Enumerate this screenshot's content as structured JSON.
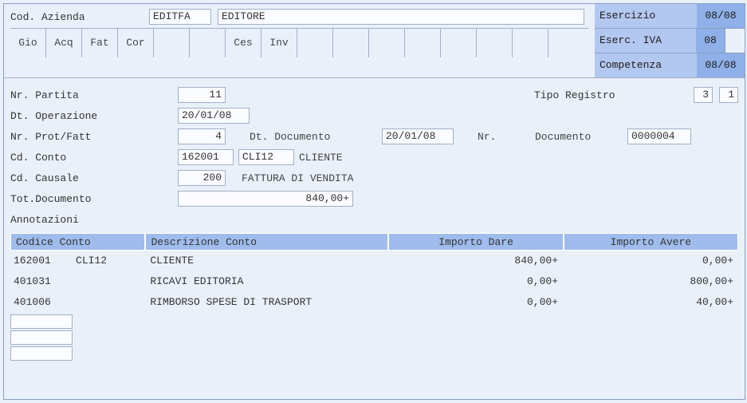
{
  "header": {
    "cod_azienda_label": "Cod. Azienda",
    "cod_azienda_code": "EDITFA",
    "cod_azienda_name": "EDITORE"
  },
  "exercise": {
    "esercizio_label": "Esercizio",
    "esercizio_val": "08/08",
    "eserc_iva_label": "Eserc. IVA",
    "eserc_iva_val": "08",
    "competenza_label": "Competenza",
    "competenza_val": "08/08"
  },
  "tabs": [
    "Gio",
    "Acq",
    "Fat",
    "Cor",
    "",
    "",
    "Ces",
    "Inv",
    "",
    "",
    "",
    "",
    "",
    "",
    "",
    ""
  ],
  "form": {
    "nr_partita_label": "Nr. Partita",
    "nr_partita": "11",
    "tipo_registro_label": "Tipo Registro",
    "tipo_registro_a": "3",
    "tipo_registro_b": "1",
    "dt_operazione_label": "Dt. Operazione",
    "dt_operazione": "20/01/08",
    "nr_prot_fatt_label": "Nr. Prot/Fatt",
    "nr_prot_fatt": "4",
    "dt_documento_label": "Dt. Documento",
    "dt_documento": "20/01/08",
    "nr_documento_label_prefix": "Nr.",
    "nr_documento_label": "Documento",
    "nr_documento": "0000004",
    "cd_conto_label": "Cd. Conto",
    "cd_conto_a": "162001",
    "cd_conto_b": "CLI12",
    "cd_conto_desc": "CLIENTE",
    "cd_causale_label": "Cd. Causale",
    "cd_causale": "200",
    "cd_causale_desc": "FATTURA DI VENDITA",
    "tot_documento_label": "Tot.Documento",
    "tot_documento": "840,00+",
    "annotazioni_label": "Annotazioni"
  },
  "grid": {
    "headers": {
      "codice": "Codice Conto",
      "descr": "Descrizione Conto",
      "dare": "Importo Dare",
      "avere": "Importo Avere"
    },
    "rows": [
      {
        "codice": "162001    CLI12",
        "descr": "CLIENTE",
        "dare": "840,00+",
        "avere": "0,00+"
      },
      {
        "codice": "401031",
        "descr": "RICAVI EDITORIA",
        "dare": "0,00+",
        "avere": "800,00+"
      },
      {
        "codice": "401006",
        "descr": "RIMBORSO SPESE DI TRASPORT",
        "dare": "0,00+",
        "avere": "40,00+"
      }
    ]
  }
}
